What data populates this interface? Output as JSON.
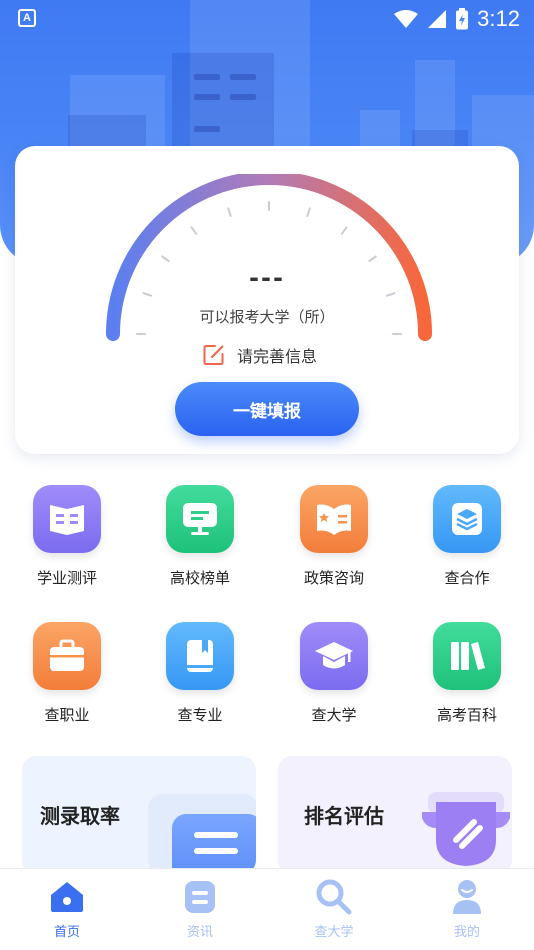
{
  "status_bar": {
    "time": "3:12",
    "app_badge": "A"
  },
  "card": {
    "gauge_value": "---",
    "gauge_caption": "可以报考大学（所）",
    "complete_info": "请完善信息",
    "fill_button": "一键填报"
  },
  "grid": [
    {
      "label": "学业测评",
      "icon": "book-open-icon",
      "color": "#8b7bf4"
    },
    {
      "label": "高校榜单",
      "icon": "monitor-icon",
      "color": "#2fcf8a"
    },
    {
      "label": "政策咨询",
      "icon": "open-book-icon",
      "color": "#f7934a"
    },
    {
      "label": "查合作",
      "icon": "layers-icon",
      "color": "#4aa8f7"
    },
    {
      "label": "查职业",
      "icon": "briefcase-icon",
      "color": "#f7934a"
    },
    {
      "label": "查专业",
      "icon": "book-icon",
      "color": "#4aa8f7"
    },
    {
      "label": "查大学",
      "icon": "graduation-cap-icon",
      "color": "#8b7bf4"
    },
    {
      "label": "高考百科",
      "icon": "books-icon",
      "color": "#2fcf8a"
    }
  ],
  "promos": [
    {
      "title": "测录取率",
      "icon": "document-icon"
    },
    {
      "title": "排名评估",
      "icon": "trophy-icon"
    }
  ],
  "tabbar": [
    {
      "label": "首页",
      "icon": "home-icon",
      "active": true
    },
    {
      "label": "资讯",
      "icon": "news-icon",
      "active": false
    },
    {
      "label": "查大学",
      "icon": "search-icon",
      "active": false
    },
    {
      "label": "我的",
      "icon": "profile-icon",
      "active": false
    }
  ]
}
